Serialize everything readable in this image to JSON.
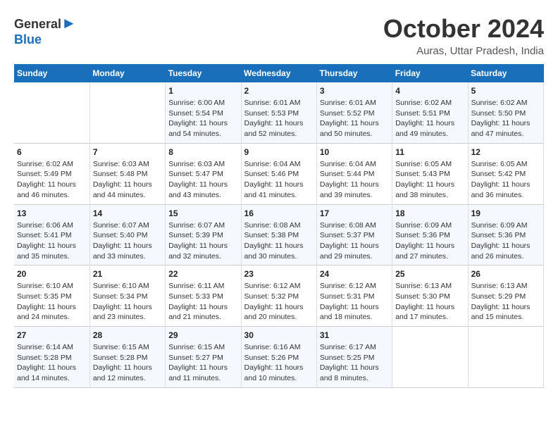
{
  "logo": {
    "general": "General",
    "blue": "Blue"
  },
  "header": {
    "month": "October 2024",
    "location": "Auras, Uttar Pradesh, India"
  },
  "days_of_week": [
    "Sunday",
    "Monday",
    "Tuesday",
    "Wednesday",
    "Thursday",
    "Friday",
    "Saturday"
  ],
  "weeks": [
    [
      {
        "num": "",
        "sunrise": "",
        "sunset": "",
        "daylight": "",
        "empty": true
      },
      {
        "num": "",
        "sunrise": "",
        "sunset": "",
        "daylight": "",
        "empty": true
      },
      {
        "num": "1",
        "sunrise": "Sunrise: 6:00 AM",
        "sunset": "Sunset: 5:54 PM",
        "daylight": "Daylight: 11 hours and 54 minutes."
      },
      {
        "num": "2",
        "sunrise": "Sunrise: 6:01 AM",
        "sunset": "Sunset: 5:53 PM",
        "daylight": "Daylight: 11 hours and 52 minutes."
      },
      {
        "num": "3",
        "sunrise": "Sunrise: 6:01 AM",
        "sunset": "Sunset: 5:52 PM",
        "daylight": "Daylight: 11 hours and 50 minutes."
      },
      {
        "num": "4",
        "sunrise": "Sunrise: 6:02 AM",
        "sunset": "Sunset: 5:51 PM",
        "daylight": "Daylight: 11 hours and 49 minutes."
      },
      {
        "num": "5",
        "sunrise": "Sunrise: 6:02 AM",
        "sunset": "Sunset: 5:50 PM",
        "daylight": "Daylight: 11 hours and 47 minutes."
      }
    ],
    [
      {
        "num": "6",
        "sunrise": "Sunrise: 6:02 AM",
        "sunset": "Sunset: 5:49 PM",
        "daylight": "Daylight: 11 hours and 46 minutes."
      },
      {
        "num": "7",
        "sunrise": "Sunrise: 6:03 AM",
        "sunset": "Sunset: 5:48 PM",
        "daylight": "Daylight: 11 hours and 44 minutes."
      },
      {
        "num": "8",
        "sunrise": "Sunrise: 6:03 AM",
        "sunset": "Sunset: 5:47 PM",
        "daylight": "Daylight: 11 hours and 43 minutes."
      },
      {
        "num": "9",
        "sunrise": "Sunrise: 6:04 AM",
        "sunset": "Sunset: 5:46 PM",
        "daylight": "Daylight: 11 hours and 41 minutes."
      },
      {
        "num": "10",
        "sunrise": "Sunrise: 6:04 AM",
        "sunset": "Sunset: 5:44 PM",
        "daylight": "Daylight: 11 hours and 39 minutes."
      },
      {
        "num": "11",
        "sunrise": "Sunrise: 6:05 AM",
        "sunset": "Sunset: 5:43 PM",
        "daylight": "Daylight: 11 hours and 38 minutes."
      },
      {
        "num": "12",
        "sunrise": "Sunrise: 6:05 AM",
        "sunset": "Sunset: 5:42 PM",
        "daylight": "Daylight: 11 hours and 36 minutes."
      }
    ],
    [
      {
        "num": "13",
        "sunrise": "Sunrise: 6:06 AM",
        "sunset": "Sunset: 5:41 PM",
        "daylight": "Daylight: 11 hours and 35 minutes."
      },
      {
        "num": "14",
        "sunrise": "Sunrise: 6:07 AM",
        "sunset": "Sunset: 5:40 PM",
        "daylight": "Daylight: 11 hours and 33 minutes."
      },
      {
        "num": "15",
        "sunrise": "Sunrise: 6:07 AM",
        "sunset": "Sunset: 5:39 PM",
        "daylight": "Daylight: 11 hours and 32 minutes."
      },
      {
        "num": "16",
        "sunrise": "Sunrise: 6:08 AM",
        "sunset": "Sunset: 5:38 PM",
        "daylight": "Daylight: 11 hours and 30 minutes."
      },
      {
        "num": "17",
        "sunrise": "Sunrise: 6:08 AM",
        "sunset": "Sunset: 5:37 PM",
        "daylight": "Daylight: 11 hours and 29 minutes."
      },
      {
        "num": "18",
        "sunrise": "Sunrise: 6:09 AM",
        "sunset": "Sunset: 5:36 PM",
        "daylight": "Daylight: 11 hours and 27 minutes."
      },
      {
        "num": "19",
        "sunrise": "Sunrise: 6:09 AM",
        "sunset": "Sunset: 5:36 PM",
        "daylight": "Daylight: 11 hours and 26 minutes."
      }
    ],
    [
      {
        "num": "20",
        "sunrise": "Sunrise: 6:10 AM",
        "sunset": "Sunset: 5:35 PM",
        "daylight": "Daylight: 11 hours and 24 minutes."
      },
      {
        "num": "21",
        "sunrise": "Sunrise: 6:10 AM",
        "sunset": "Sunset: 5:34 PM",
        "daylight": "Daylight: 11 hours and 23 minutes."
      },
      {
        "num": "22",
        "sunrise": "Sunrise: 6:11 AM",
        "sunset": "Sunset: 5:33 PM",
        "daylight": "Daylight: 11 hours and 21 minutes."
      },
      {
        "num": "23",
        "sunrise": "Sunrise: 6:12 AM",
        "sunset": "Sunset: 5:32 PM",
        "daylight": "Daylight: 11 hours and 20 minutes."
      },
      {
        "num": "24",
        "sunrise": "Sunrise: 6:12 AM",
        "sunset": "Sunset: 5:31 PM",
        "daylight": "Daylight: 11 hours and 18 minutes."
      },
      {
        "num": "25",
        "sunrise": "Sunrise: 6:13 AM",
        "sunset": "Sunset: 5:30 PM",
        "daylight": "Daylight: 11 hours and 17 minutes."
      },
      {
        "num": "26",
        "sunrise": "Sunrise: 6:13 AM",
        "sunset": "Sunset: 5:29 PM",
        "daylight": "Daylight: 11 hours and 15 minutes."
      }
    ],
    [
      {
        "num": "27",
        "sunrise": "Sunrise: 6:14 AM",
        "sunset": "Sunset: 5:28 PM",
        "daylight": "Daylight: 11 hours and 14 minutes."
      },
      {
        "num": "28",
        "sunrise": "Sunrise: 6:15 AM",
        "sunset": "Sunset: 5:28 PM",
        "daylight": "Daylight: 11 hours and 12 minutes."
      },
      {
        "num": "29",
        "sunrise": "Sunrise: 6:15 AM",
        "sunset": "Sunset: 5:27 PM",
        "daylight": "Daylight: 11 hours and 11 minutes."
      },
      {
        "num": "30",
        "sunrise": "Sunrise: 6:16 AM",
        "sunset": "Sunset: 5:26 PM",
        "daylight": "Daylight: 11 hours and 10 minutes."
      },
      {
        "num": "31",
        "sunrise": "Sunrise: 6:17 AM",
        "sunset": "Sunset: 5:25 PM",
        "daylight": "Daylight: 11 hours and 8 minutes."
      },
      {
        "num": "",
        "sunrise": "",
        "sunset": "",
        "daylight": "",
        "empty": true
      },
      {
        "num": "",
        "sunrise": "",
        "sunset": "",
        "daylight": "",
        "empty": true
      }
    ]
  ]
}
